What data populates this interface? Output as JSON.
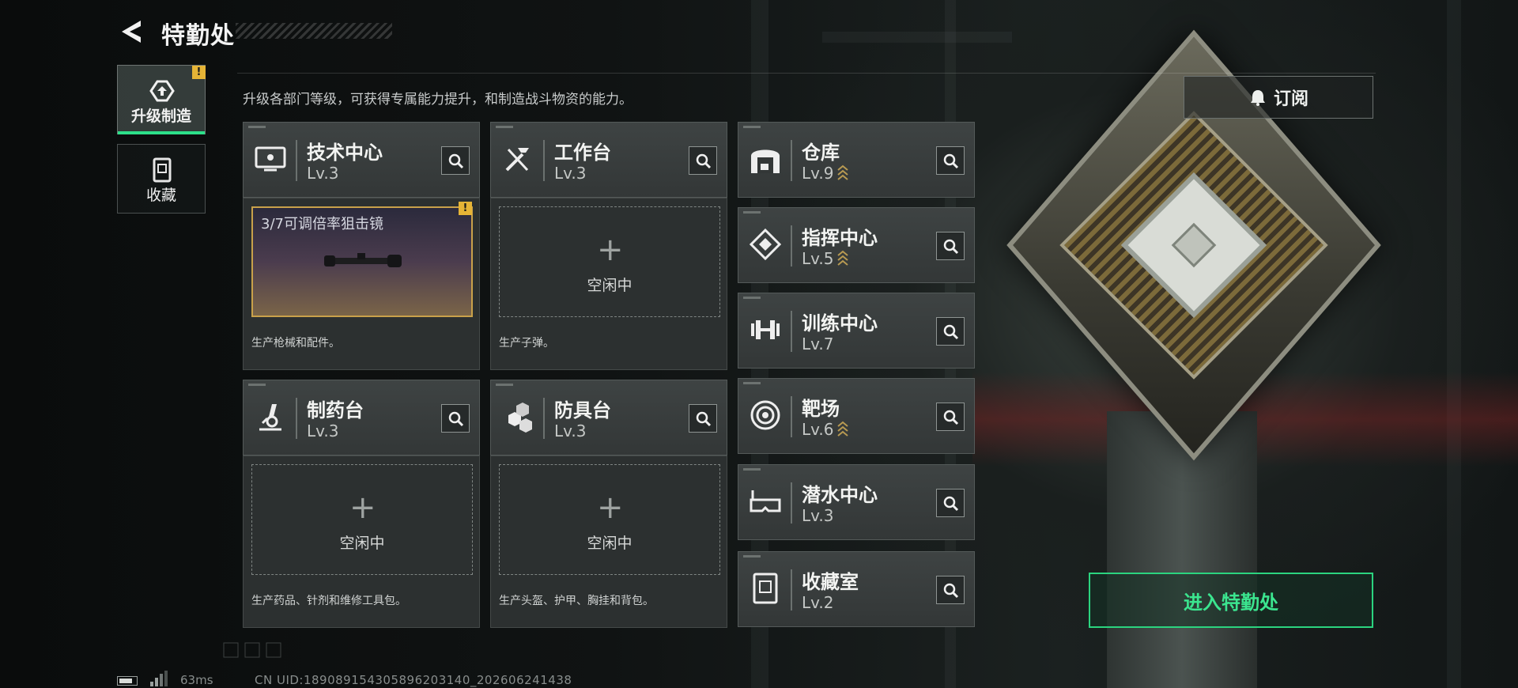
{
  "header": {
    "title": "特勤处",
    "back_icon": "back-arrow-icon"
  },
  "subtitle": "升级各部门等级，可获得专属能力提升，和制造战斗物资的能力。",
  "tabs": [
    {
      "label": "升级制造",
      "icon": "upgrade-craft-icon",
      "active": true,
      "alert": "!"
    },
    {
      "label": "收藏",
      "icon": "collection-icon",
      "active": false
    }
  ],
  "subscribe": {
    "label": "订阅",
    "icon": "subscribe-bell-icon"
  },
  "production_stations": [
    {
      "name": "技术中心",
      "level": "Lv.3",
      "icon": "tech-center-icon",
      "slot": {
        "filled": true,
        "item": "3/7可调倍率狙击镜",
        "alert": "!"
      },
      "desc": "生产枪械和配件。"
    },
    {
      "name": "工作台",
      "level": "Lv.3",
      "icon": "workbench-tools-icon",
      "slot": {
        "filled": false,
        "label": "空闲中"
      },
      "desc": "生产子弹。"
    },
    {
      "name": "制药台",
      "level": "Lv.3",
      "icon": "pharmacy-microscope-icon",
      "slot": {
        "filled": false,
        "label": "空闲中"
      },
      "desc": "生产药品、针剂和维修工具包。"
    },
    {
      "name": "防具台",
      "level": "Lv.3",
      "icon": "armor-bench-icon",
      "slot": {
        "filled": false,
        "label": "空闲中"
      },
      "desc": "生产头盔、护甲、胸挂和背包。"
    }
  ],
  "facilities": [
    {
      "name": "仓库",
      "level": "Lv.9",
      "icon": "warehouse-icon",
      "upgradable": true
    },
    {
      "name": "指挥中心",
      "level": "Lv.5",
      "icon": "command-center-icon",
      "upgradable": true
    },
    {
      "name": "训练中心",
      "level": "Lv.7",
      "icon": "dumbbell-icon",
      "upgradable": false
    },
    {
      "name": "靶场",
      "level": "Lv.6",
      "icon": "target-range-icon",
      "upgradable": true
    },
    {
      "name": "潜水中心",
      "level": "Lv.3",
      "icon": "diving-mask-icon",
      "upgradable": false
    },
    {
      "name": "收藏室",
      "level": "Lv.2",
      "icon": "collection-room-icon",
      "upgradable": false
    }
  ],
  "enter_button": {
    "label": "进入特勤处"
  },
  "footer": {
    "ping": "63ms",
    "uid": "CN UID:189089154305896203140_202606241438"
  },
  "colors": {
    "accent": "#2de08a",
    "alert": "#e6b436",
    "upgrade_chevron": "#b89a52"
  }
}
